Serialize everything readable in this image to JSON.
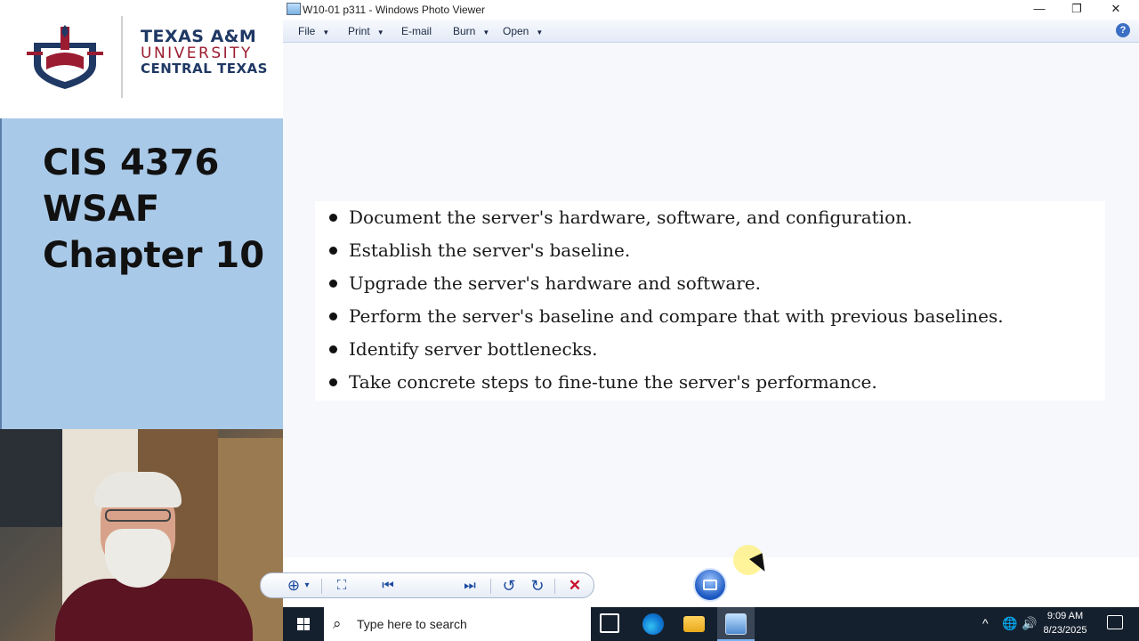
{
  "slide_panel": {
    "logo": {
      "line1": "TEXAS A&M",
      "line2": "UNIVERSITY",
      "line3": "CENTRAL TEXAS"
    },
    "title_lines": [
      "CIS 4376",
      "WSAF",
      "Chapter 10"
    ]
  },
  "photo_viewer": {
    "window_title": "W10-01 p311 - Windows Photo Viewer",
    "window_buttons": {
      "minimize": "—",
      "restore": "❐",
      "close": "✕"
    },
    "menu": [
      {
        "label": "File",
        "has_dropdown": true
      },
      {
        "label": "Print",
        "has_dropdown": true
      },
      {
        "label": "E-mail",
        "has_dropdown": false
      },
      {
        "label": "Burn",
        "has_dropdown": true
      },
      {
        "label": "Open",
        "has_dropdown": true
      }
    ],
    "help_label": "?",
    "image_bullets": [
      "Document the server's hardware, software, and configuration.",
      "Establish the server's baseline.",
      "Upgrade the server's hardware and software.",
      "Perform the server's baseline and compare that with previous baselines.",
      "Identify server bottlenecks.",
      "Take concrete steps to fine-tune the server's performance."
    ],
    "controls": {
      "zoom_icon": "⊕",
      "dropdown_icon": "▾",
      "actual_size_icon": "⛶",
      "previous_icon": "⏮",
      "next_icon": "⏭",
      "rotate_ccw_icon": "↺",
      "rotate_cw_icon": "↻",
      "delete_icon": "✕"
    }
  },
  "taskbar": {
    "search_placeholder": "Type here to search",
    "search_icon": "⌕",
    "tray": {
      "chevron": "^",
      "globe": "🌐",
      "speaker": "🔊"
    },
    "clock_time": "9:09 AM",
    "clock_date": "8/23/2025"
  },
  "colors": {
    "slide_blue": "#a9c9e8",
    "tamu_navy": "#1f3864",
    "tamu_maroon": "#9b1b30",
    "taskbar": "#15202e",
    "delete_red": "#c8102e"
  }
}
